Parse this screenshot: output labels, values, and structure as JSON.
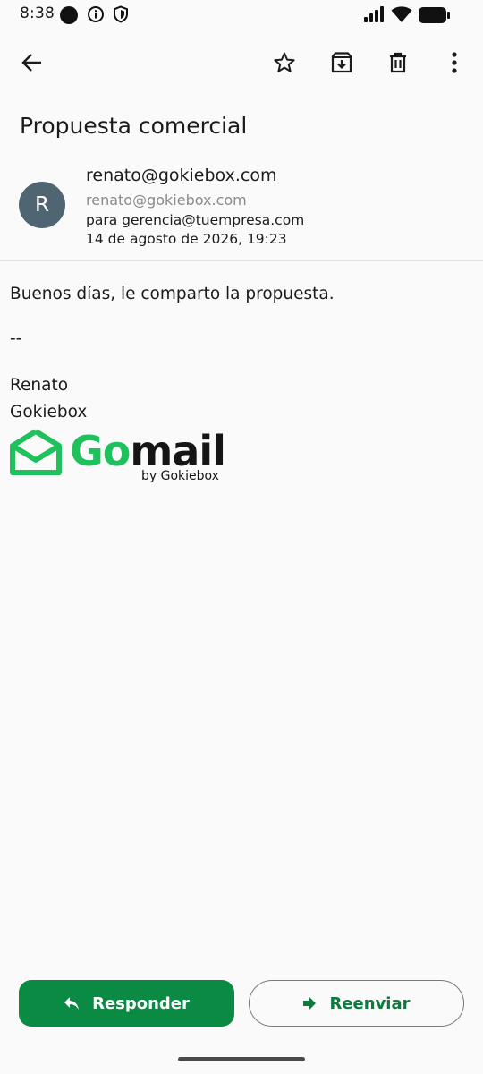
{
  "status_bar": {
    "time": "8:38"
  },
  "toolbar": {
    "back_icon": "arrow-back-icon",
    "star_icon": "star-outline-icon",
    "archive_icon": "archive-icon",
    "delete_icon": "trash-icon",
    "more_icon": "more-vert-icon"
  },
  "email": {
    "subject": "Propuesta comercial",
    "avatar_letter": "R",
    "sender_name": "renato@gokiebox.com",
    "sender_email": "renato@gokiebox.com",
    "recipient": "para gerencia@tuempresa.com",
    "date": "14 de agosto de 2026, 19:23",
    "body": {
      "greeting": "Buenos días, le comparto la propuesta.",
      "separator": "--",
      "signature_name": "Renato",
      "signature_company": "Gokiebox"
    },
    "logo": {
      "go": "Go",
      "mail": "mail",
      "byline": "by Gokiebox"
    }
  },
  "actions": {
    "reply_label": "Responder",
    "forward_label": "Reenviar"
  },
  "colors": {
    "primary": "#0b8a44",
    "logo_green": "#1fc15c",
    "avatar": "#4f6571"
  }
}
